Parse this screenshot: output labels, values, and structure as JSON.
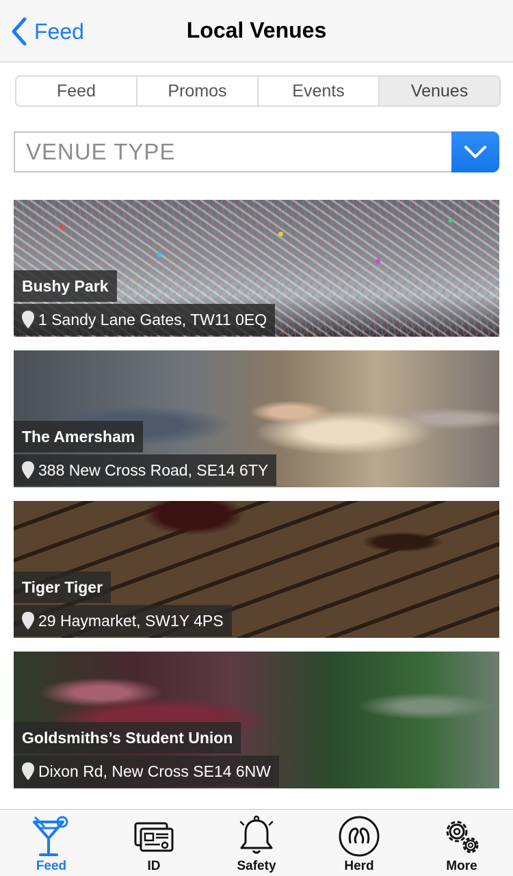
{
  "nav": {
    "back_label": "Feed",
    "title": "Local Venues"
  },
  "segments": [
    {
      "label": "Feed",
      "active": false
    },
    {
      "label": "Promos",
      "active": false
    },
    {
      "label": "Events",
      "active": false
    },
    {
      "label": "Venues",
      "active": true
    }
  ],
  "filter": {
    "placeholder": "VENUE TYPE"
  },
  "venues": [
    {
      "name": "Bushy Park",
      "address": "1 Sandy Lane Gates, TW11 0EQ"
    },
    {
      "name": "The Amersham",
      "address": "388 New Cross Road, SE14 6TY"
    },
    {
      "name": "Tiger Tiger",
      "address": "29 Haymarket, SW1Y 4PS"
    },
    {
      "name": "Goldsmiths’s Student Union",
      "address": "Dixon Rd, New Cross SE14 6NW"
    }
  ],
  "tabs": [
    {
      "label": "Feed",
      "icon": "cocktail-icon",
      "active": true
    },
    {
      "label": "ID",
      "icon": "id-card-icon",
      "active": false
    },
    {
      "label": "Safety",
      "icon": "bell-icon",
      "active": false
    },
    {
      "label": "Herd",
      "icon": "herd-icon",
      "active": false
    },
    {
      "label": "More",
      "icon": "gear-icon",
      "active": false
    }
  ],
  "colors": {
    "accent": "#1a7cf5",
    "overlay": "#282828"
  }
}
